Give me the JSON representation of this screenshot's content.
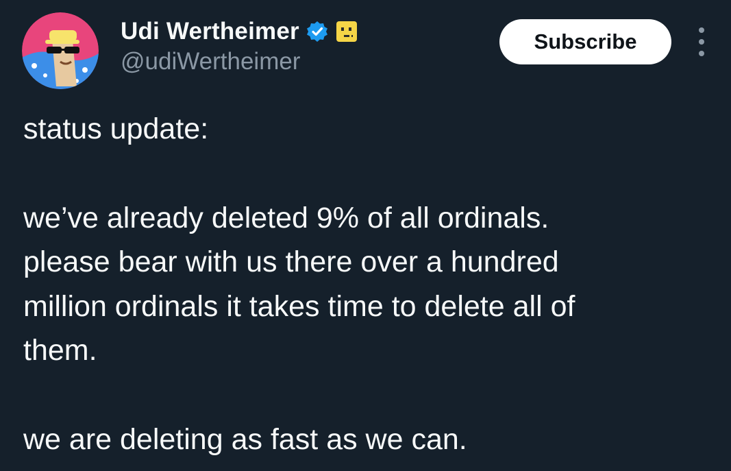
{
  "author": {
    "display_name": "Udi Wertheimer",
    "handle": "@udiWertheimer",
    "verified_icon": "verified-badge-icon",
    "emoji_icon": "face-emoji-icon",
    "avatar_icon": "cartoon-avatar-icon"
  },
  "actions": {
    "subscribe_label": "Subscribe",
    "more_icon": "more-options-icon"
  },
  "tweet": {
    "line_1": "status update:",
    "paragraph_2_lines": [
      "we’ve already deleted 9% of all ordinals.",
      "please bear with us there over a hundred",
      "million ordinals it takes time to delete all of",
      "them."
    ],
    "line_3": "we are deleting as fast as we can."
  },
  "colors": {
    "background": "#15202b",
    "text_primary": "#f7f9f9",
    "text_secondary": "#8b98a5",
    "verified_blue": "#1d9bf0",
    "emoji_yellow": "#f5d547",
    "button_bg": "#ffffff",
    "button_text": "#0f1419"
  }
}
